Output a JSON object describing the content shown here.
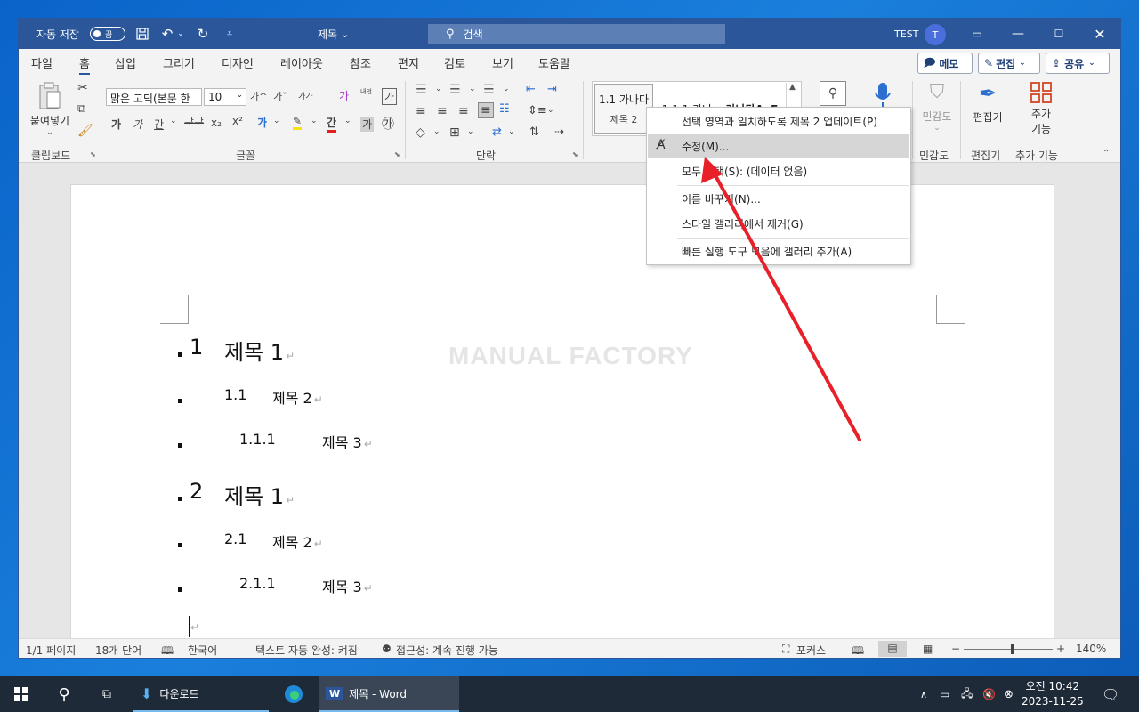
{
  "titlebar": {
    "autosave_label": "자동 저장",
    "autosave_state": "끔",
    "doc_title": "제목",
    "title_caret": "⌄",
    "search_placeholder": "검색",
    "user_name": "TEST",
    "user_initial": "T",
    "icons": [
      "save-icon",
      "undo-icon",
      "redo-icon",
      "customize-qat-icon",
      "ribbon-display-icon",
      "minimize-icon",
      "maximize-icon",
      "close-icon"
    ]
  },
  "menu": {
    "tabs": [
      "파일",
      "홈",
      "삽입",
      "그리기",
      "디자인",
      "레이아웃",
      "참조",
      "편지",
      "검토",
      "보기",
      "도움말"
    ],
    "active_tab": "홈",
    "comments_label": "메모",
    "editing_label": "편집",
    "share_label": "공유"
  },
  "ribbon": {
    "clipboard": {
      "paste_label": "붙여넣기",
      "group_label": "클립보드"
    },
    "font": {
      "font_name": "맑은 고딕(본문 한",
      "font_size": "10",
      "group_label": "글꼴",
      "btn_bold": "가",
      "btn_italic": "가",
      "btn_underline": "간",
      "btn_strike": "ᅶ",
      "btn_sub": "x₂",
      "btn_sup": "x²",
      "btn_increase": "가^",
      "btn_decrease": "가ˇ",
      "btn_case": "가가",
      "btn_clear": "가",
      "btn_phonetic": "내천",
      "btn_border": "가",
      "btn_shade": "가",
      "btn_enclose": "㉮"
    },
    "paragraph": {
      "group_label": "단락"
    },
    "styles": {
      "cells": [
        {
          "preview": "1.1  가나다",
          "name": "제목 2"
        },
        {
          "preview": "1.1.1  가나",
          "name": ""
        },
        {
          "preview": "가나다AaE",
          "name": ""
        }
      ]
    },
    "find_label": "찾기",
    "dictate_label": "받아쓰기",
    "sensitivity": {
      "label": "민감도",
      "group_label": "민감도"
    },
    "editor": {
      "label": "편집기",
      "group_label": "편집기"
    },
    "addins": {
      "label1": "추가",
      "label2": "기능",
      "group_label": "추가 기능"
    }
  },
  "context_menu": {
    "items": [
      "선택 영역과 일치하도록 제목 2 업데이트(P)",
      "수정(M)...",
      "모두 선택(S): (데이터 없음)",
      "이름 바꾸기(N)...",
      "스타일 갤러리에서 제거(G)",
      "빠른 실행 도구 모음에 갤러리 추가(A)"
    ],
    "highlighted_index": 1
  },
  "document": {
    "watermark": "MANUAL FACTORY",
    "headings": [
      {
        "level": 1,
        "number": "1",
        "text": "제목 1"
      },
      {
        "level": 2,
        "number": "1.1",
        "text": "제목 2"
      },
      {
        "level": 3,
        "number": "1.1.1",
        "text": "제목 3"
      },
      {
        "level": 1,
        "number": "2",
        "text": "제목 1"
      },
      {
        "level": 2,
        "number": "2.1",
        "text": "제목 2"
      },
      {
        "level": 3,
        "number": "2.1.1",
        "text": "제목 3"
      }
    ],
    "paragraph_mark": "↵"
  },
  "statusbar": {
    "page": "1/1 페이지",
    "words": "18개 단어",
    "language": "한국어",
    "autocomplete": "텍스트 자동 완성: 켜짐",
    "accessibility": "접근성: 계속 진행 가능",
    "focus": "포커스",
    "zoom_minus": "−",
    "zoom_plus": "+",
    "zoom": "140%"
  },
  "taskbar": {
    "apps": [
      {
        "label": "다운로드"
      },
      {
        "label": "제목 - Word"
      }
    ],
    "clock_time": "오전 10:42",
    "clock_date": "2023-11-25"
  },
  "colors": {
    "word_blue": "#2b579a",
    "annotation_red": "#e8202a"
  }
}
